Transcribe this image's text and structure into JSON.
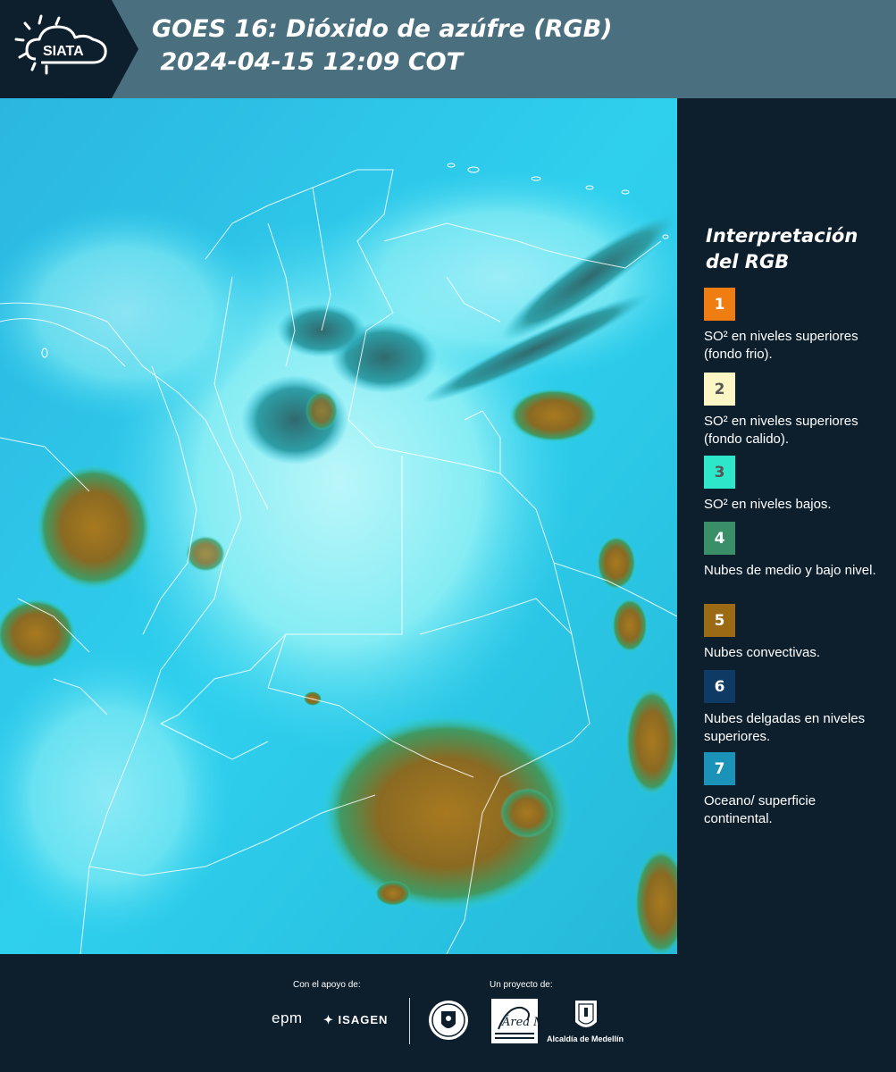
{
  "header": {
    "logo_text": "SIATA",
    "title": "GOES 16: Dióxido de azúfre (RGB)\n 2024-04-15 12:09 COT",
    "band_color": "#4a6f7f"
  },
  "legend": {
    "title": "Interpretación del RGB",
    "items": [
      {
        "number": "1",
        "color": "#f07d12",
        "number_color": "#ffffff",
        "text": "SO² en niveles superiores (fondo frio)."
      },
      {
        "number": "2",
        "color": "#fbf6c4",
        "number_color": "#555555",
        "text": "SO² en niveles superiores (fondo calido)."
      },
      {
        "number": "3",
        "color": "#2ee6c9",
        "number_color": "#555555",
        "text": "SO² en niveles bajos."
      },
      {
        "number": "4",
        "color": "#3a8f68",
        "number_color": "#ffffff",
        "text": "Nubes de medio y bajo nivel."
      },
      {
        "number": "5",
        "color": "#9a6a14",
        "number_color": "#ffffff",
        "text": "Nubes convectivas."
      },
      {
        "number": "6",
        "color": "#0e3a63",
        "number_color": "#ffffff",
        "text": "Nubes delgadas en niveles superiores."
      },
      {
        "number": "7",
        "color": "#1b93b8",
        "number_color": "#ffffff",
        "text": "Oceano/ superficie continental."
      }
    ]
  },
  "footer": {
    "support_label": "Con el apoyo de:",
    "project_label": "Un proyecto de:",
    "sponsor_1": "epm",
    "sponsor_2": "ISAGEN",
    "partner_2": "Área Metropolitana Valle de Aburrá",
    "partner_3": "Alcaldía de Medellín"
  }
}
